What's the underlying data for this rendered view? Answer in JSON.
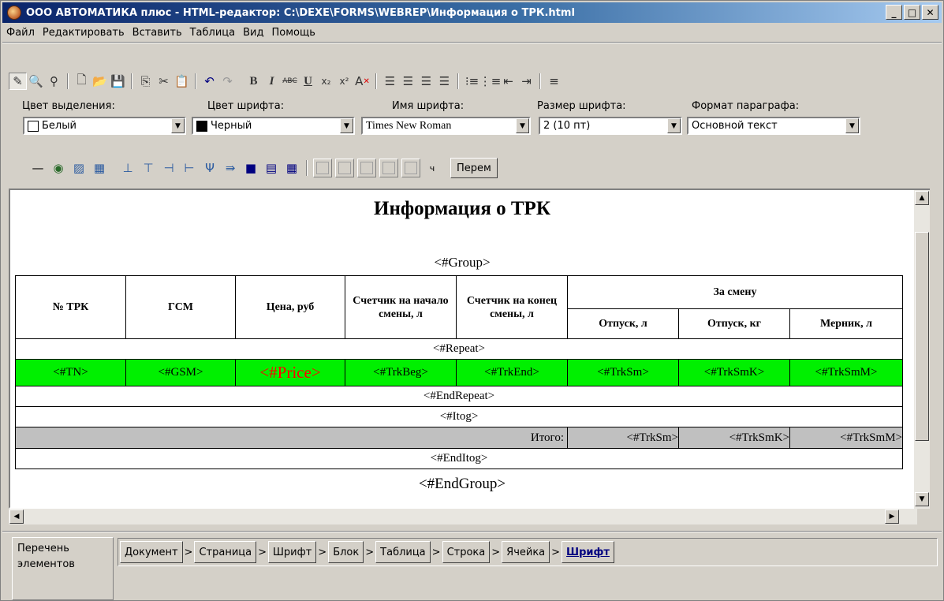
{
  "window": {
    "title": "ООО АВТОМАТИКА плюс - HTML-редактор: C:\\DEXE\\FORMS\\WEBREP\\Информация о ТРК.html",
    "minimize": "_",
    "maximize": "□",
    "close": "✕"
  },
  "menu": [
    "Файл",
    "Редактировать",
    "Вставить",
    "Таблица",
    "Вид",
    "Помощь"
  ],
  "format": {
    "highlight_label": "Цвет выделения:",
    "highlight_value": "Белый",
    "highlight_color": "#ffffff",
    "font_color_label": "Цвет шрифта:",
    "font_color_value": "Черный",
    "font_color": "#000000",
    "font_name_label": "Имя шрифта:",
    "font_name_value": "Times New Roman",
    "font_size_label": "Размер шрифта:",
    "font_size_value": "2 (10 пт)",
    "paragraph_label": "Формат параграфа:",
    "paragraph_value": "Основной текст"
  },
  "toolbar3": {
    "perem_label": "Перем",
    "cell_hint": "ч"
  },
  "document": {
    "title": "Информация о ТРК",
    "group_open": "<#Group>",
    "group_close": "<#EndGroup>",
    "table": {
      "h_num": "№ ТРК",
      "h_gsm": "ГСМ",
      "h_price": "Цена, руб",
      "h_counter_start": "Счетчик на начало смены, л",
      "h_counter_end": "Счетчик на конец смены, л",
      "h_shift": "За смену",
      "h_release_l": "Отпуск, л",
      "h_release_kg": "Отпуск, кг",
      "h_mernik": "Мерник, л",
      "repeat": "<#Repeat>",
      "row": [
        "<#TN>",
        "<#GSM>",
        "<#Price>",
        "<#TrkBeg>",
        "<#TrkEnd>",
        "<#TrkSm>",
        "<#TrkSmK>",
        "<#TrkSmM>"
      ],
      "end_repeat": "<#EndRepeat>",
      "itog": "<#Itog>",
      "total_label": "Итого:",
      "total": [
        "<#TrkSm>",
        "<#TrkSmK>",
        "<#TrkSmM>"
      ],
      "end_itog": "<#EndItog>"
    }
  },
  "bottom": {
    "elements_label": "Перечень элементов",
    "crumbs": [
      "Документ",
      "Страница",
      "Шрифт",
      "Блок",
      "Таблица",
      "Строка",
      "Ячейка",
      "Шрифт"
    ],
    "crumb_sep": ">"
  },
  "colors": {
    "row_highlight": "#00f000",
    "price_text": "#ff0000",
    "total_row": "#c0c0c0"
  }
}
